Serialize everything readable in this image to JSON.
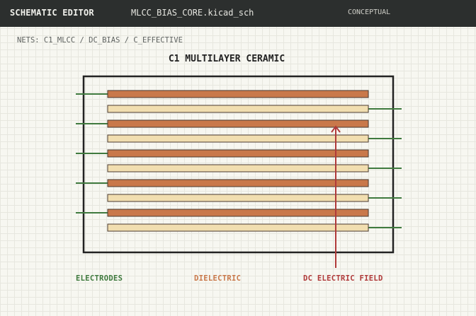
{
  "titlebar": {
    "app_title": "SCHEMATIC EDITOR",
    "file_name": "MLCC_BIAS_CORE.kicad_sch",
    "mode": "CONCEPTUAL"
  },
  "nets": "NETS: C1_MLCC / DC_BIAS / C_EFFECTIVE",
  "component": {
    "title": "C1 MULTILAYER CERAMIC",
    "layer_sequence": [
      "electrode",
      "dielectric",
      "electrode",
      "dielectric",
      "electrode",
      "dielectric",
      "electrode",
      "dielectric",
      "electrode",
      "dielectric"
    ]
  },
  "legend": {
    "electrodes": "ELECTRODES",
    "dielectric": "DIELECTRIC",
    "field": "DC ELECTRIC FIELD"
  },
  "colors": {
    "titlebar": "#2c2f2e",
    "electrode_lead": "#3f7a3e",
    "electrode_plate": "#c9784a",
    "dielectric": "#f1deb0",
    "field_arrow": "#b03a3a",
    "body_outline": "#222222"
  }
}
